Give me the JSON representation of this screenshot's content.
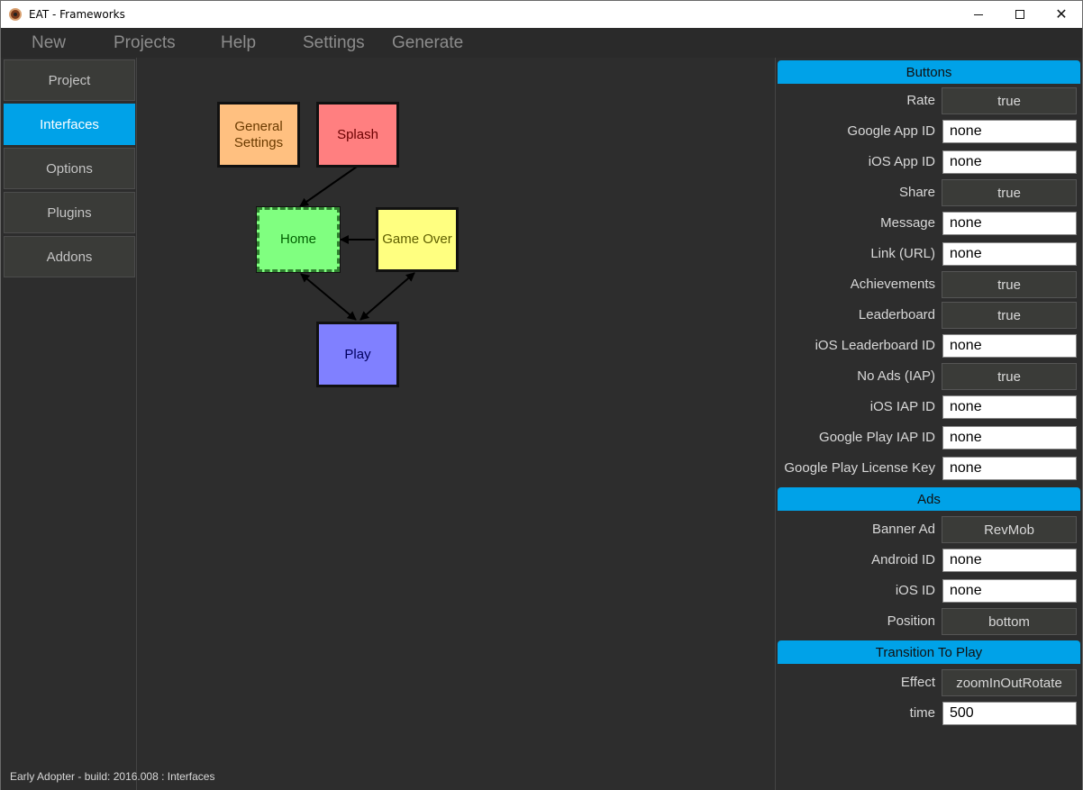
{
  "window": {
    "title": "EAT - Frameworks"
  },
  "menu": [
    "New",
    "Projects",
    "Help",
    "Settings",
    "Generate"
  ],
  "sidebar": {
    "items": [
      {
        "label": "Project",
        "active": false
      },
      {
        "label": "Interfaces",
        "active": true
      },
      {
        "label": "Options",
        "active": false
      },
      {
        "label": "Plugins",
        "active": false
      },
      {
        "label": "Addons",
        "active": false
      }
    ]
  },
  "diagram": {
    "nodes": {
      "general_settings": {
        "label": "General Settings",
        "color": "#ffc080"
      },
      "splash": {
        "label": "Splash",
        "color": "#ff7f80"
      },
      "home": {
        "label": "Home",
        "color": "#80ff80",
        "selected": true
      },
      "game_over": {
        "label": "Game Over",
        "color": "#ffff80"
      },
      "play": {
        "label": "Play",
        "color": "#8080ff"
      }
    }
  },
  "status_text": "Early Adopter - build: 2016.008 : Interfaces",
  "panel": {
    "buttons": {
      "header": "Buttons",
      "rate": {
        "label": "Rate",
        "value": "true"
      },
      "google_app_id": {
        "label": "Google App ID",
        "value": "none"
      },
      "ios_app_id": {
        "label": "iOS App ID",
        "value": "none"
      },
      "share": {
        "label": "Share",
        "value": "true"
      },
      "message": {
        "label": "Message",
        "value": "none"
      },
      "link": {
        "label": "Link (URL)",
        "value": "none"
      },
      "achievements": {
        "label": "Achievements",
        "value": "true"
      },
      "leaderboard": {
        "label": "Leaderboard",
        "value": "true"
      },
      "ios_leaderboard_id": {
        "label": "iOS Leaderboard ID",
        "value": "none"
      },
      "no_ads": {
        "label": "No Ads (IAP)",
        "value": "true"
      },
      "ios_iap_id": {
        "label": "iOS IAP ID",
        "value": "none"
      },
      "google_play_iap_id": {
        "label": "Google Play IAP ID",
        "value": "none"
      },
      "google_play_license_key": {
        "label": "Google Play License Key",
        "value": "none"
      }
    },
    "ads": {
      "header": "Ads",
      "banner_ad": {
        "label": "Banner Ad",
        "value": "RevMob"
      },
      "android_id": {
        "label": "Android ID",
        "value": "none"
      },
      "ios_id": {
        "label": "iOS ID",
        "value": "none"
      },
      "position": {
        "label": "Position",
        "value": "bottom"
      }
    },
    "transition": {
      "header": "Transition To Play",
      "effect": {
        "label": "Effect",
        "value": "zoomInOutRotate"
      },
      "time": {
        "label": "time",
        "value": "500"
      }
    }
  },
  "colors": {
    "accent": "#00a2e8",
    "background": "#2d2d2d"
  }
}
